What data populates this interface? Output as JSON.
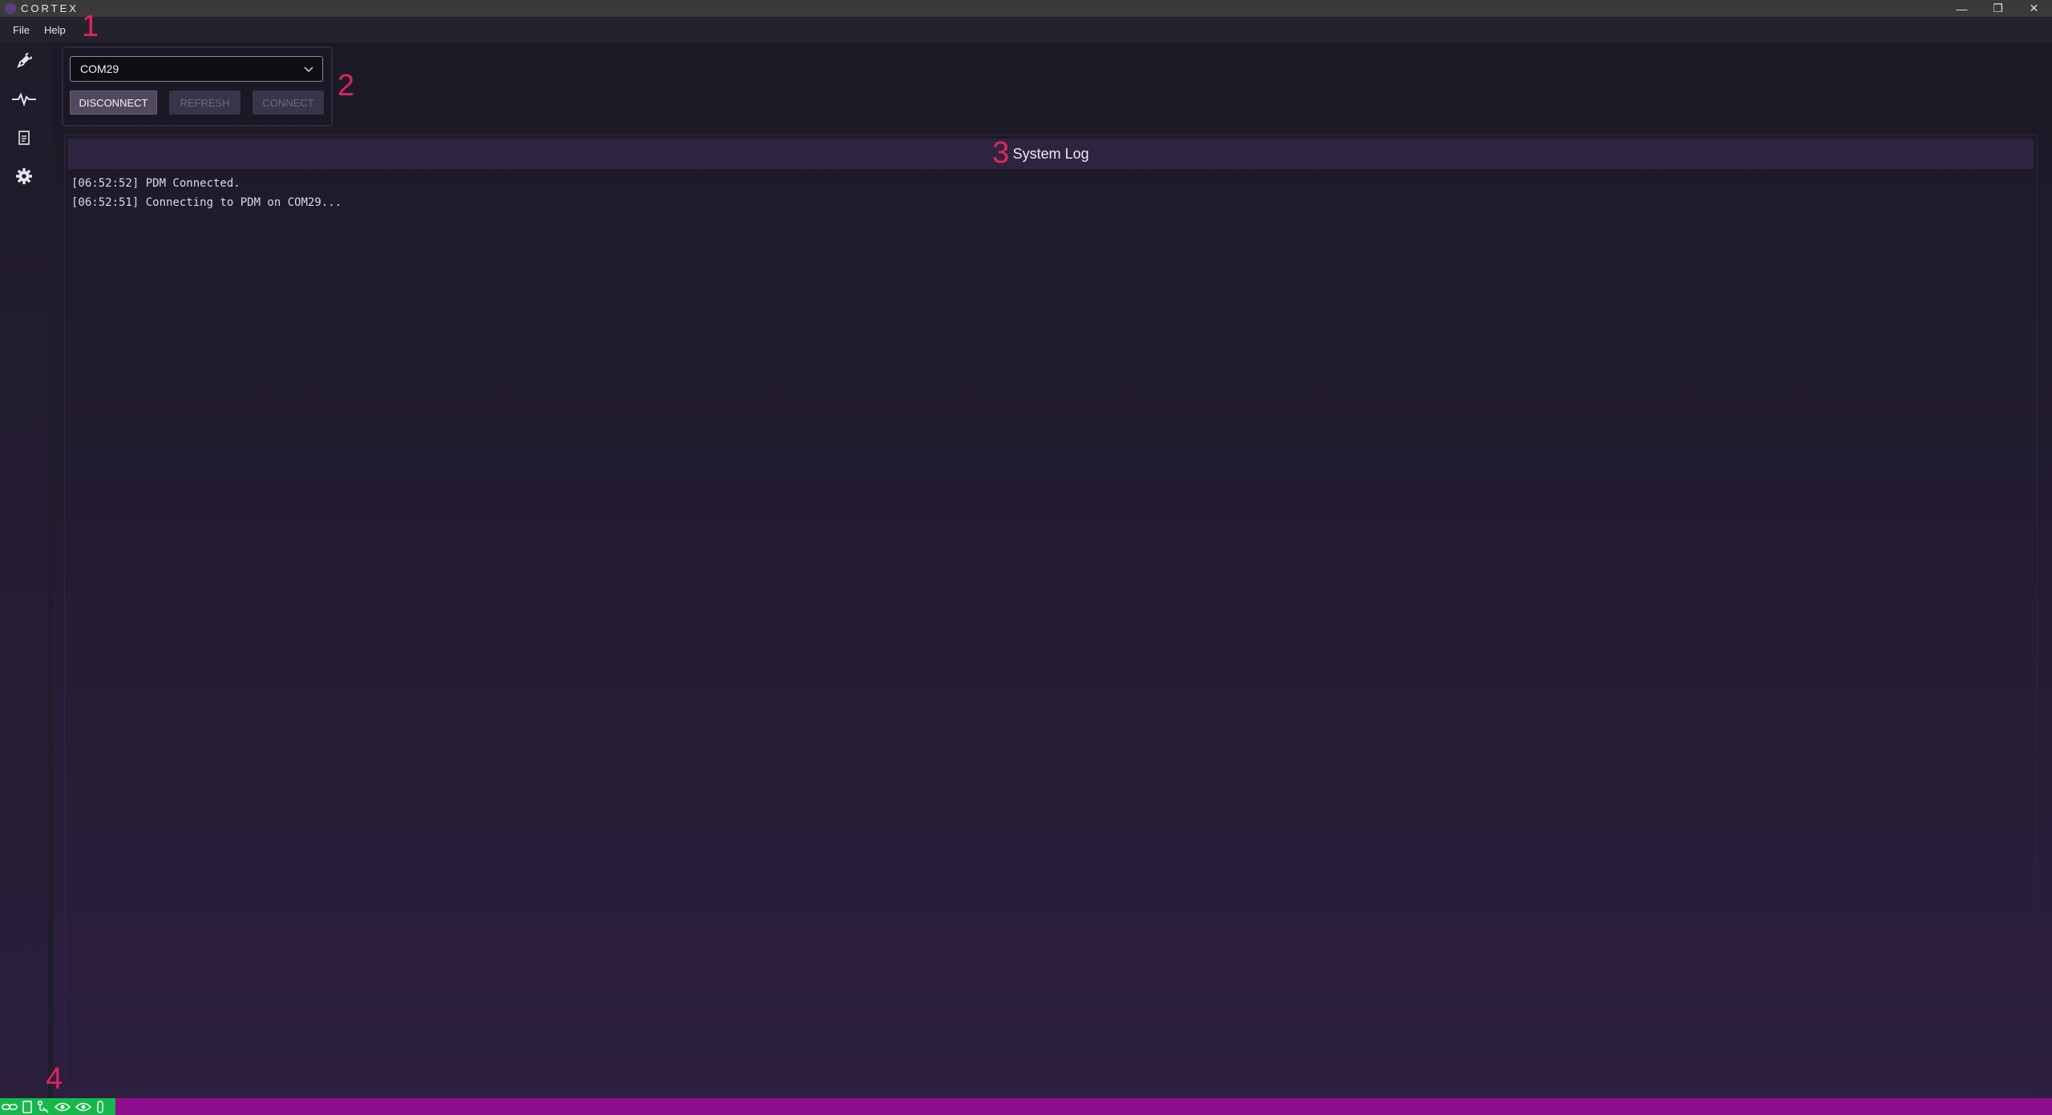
{
  "window": {
    "title": "CORTEX",
    "minimize_glyph": "—",
    "restore_glyph": "❐",
    "close_glyph": "✕"
  },
  "menu": {
    "items": [
      {
        "label": "File"
      },
      {
        "label": "Help"
      }
    ]
  },
  "annotations": [
    "1",
    "2",
    "3",
    "4"
  ],
  "sidebar": {
    "items": [
      {
        "icon": "connection-icon"
      },
      {
        "icon": "pulse-icon"
      },
      {
        "icon": "document-icon"
      },
      {
        "icon": "gear-icon"
      }
    ]
  },
  "connection": {
    "port_value": "COM29",
    "disconnect_label": "DISCONNECT",
    "refresh_label": "REFRESH",
    "connect_label": "CONNECT"
  },
  "log": {
    "title": "System Log",
    "lines": [
      "[06:52:52] PDM Connected.",
      "[06:52:51] Connecting to PDM on COM29..."
    ]
  },
  "status": {
    "icons": [
      "link-icon",
      "device-icon",
      "network-icon",
      "eye-icon",
      "eye-icon",
      "attachment-icon"
    ]
  },
  "colors": {
    "status_bar": "#8e0f8e",
    "status_icons_bg": "#16b84c",
    "annotation": "#e0245e"
  }
}
